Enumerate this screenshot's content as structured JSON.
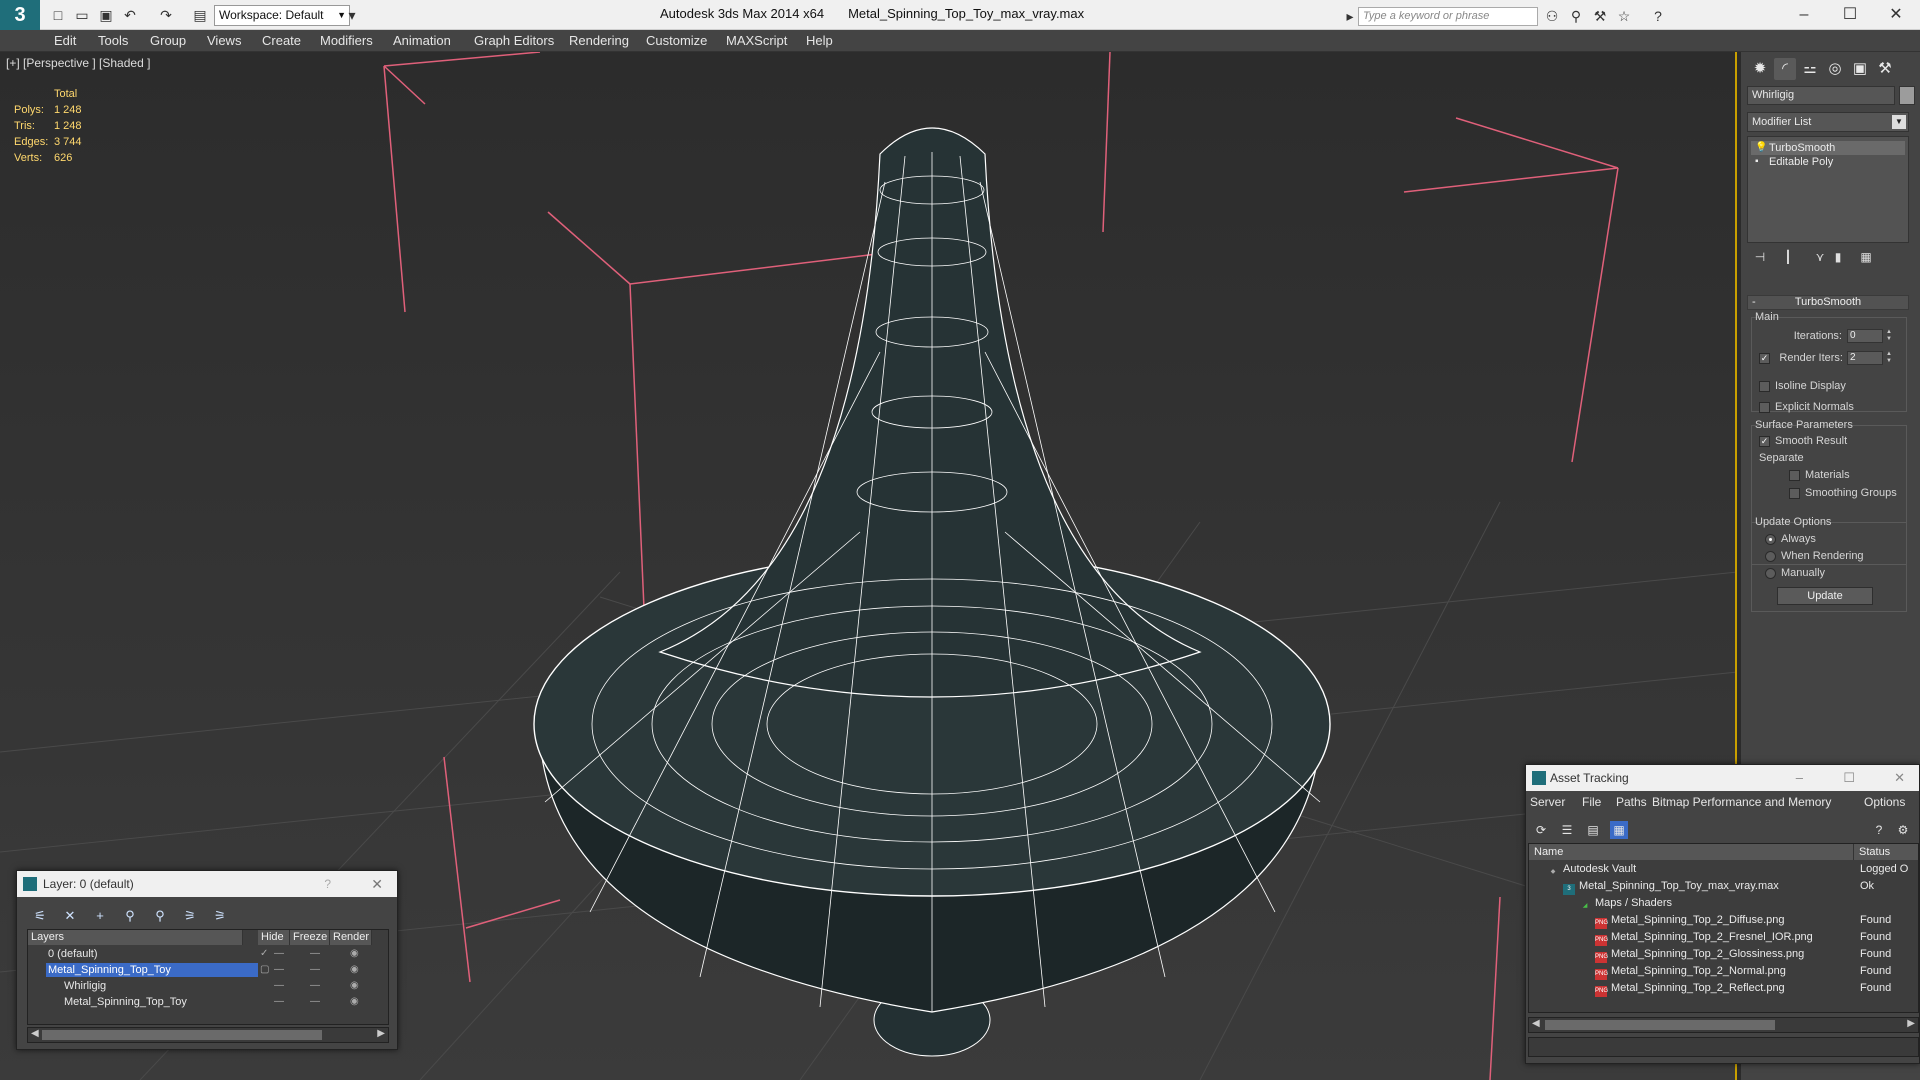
{
  "title_bar": {
    "app_name": "Autodesk 3ds Max  2014 x64",
    "file_name": "Metal_Spinning_Top_Toy_max_vray.max",
    "workspace": "Workspace: Default",
    "search_placeholder": "Type a keyword or phrase"
  },
  "menu": [
    "Edit",
    "Tools",
    "Group",
    "Views",
    "Create",
    "Modifiers",
    "Animation",
    "Graph Editors",
    "Rendering",
    "Customize",
    "MAXScript",
    "Help"
  ],
  "viewport": {
    "label": "[+] [Perspective ] [Shaded ]",
    "stats": {
      "header": "Total",
      "rows": [
        {
          "k": "Polys:",
          "v": "1 248"
        },
        {
          "k": "Tris:",
          "v": "1 248"
        },
        {
          "k": "Edges:",
          "v": "3 744"
        },
        {
          "k": "Verts:",
          "v": "626"
        }
      ]
    }
  },
  "command_panel": {
    "object_name": "Whirligig",
    "modifier_list": "Modifier List",
    "stack": [
      "TurboSmooth",
      "Editable Poly"
    ],
    "turbosmooth": {
      "header": "TurboSmooth",
      "main_label": "Main",
      "iterations_label": "Iterations:",
      "iterations_value": "0",
      "render_iters_label": "Render Iters:",
      "render_iters_value": "2",
      "isoline": "Isoline Display",
      "explicit_normals": "Explicit Normals",
      "surface_params": "Surface Parameters",
      "smooth_result": "Smooth Result",
      "separate": "Separate",
      "materials": "Materials",
      "smoothing_groups": "Smoothing Groups",
      "update_options": "Update Options",
      "always": "Always",
      "when_rendering": "When Rendering",
      "manually": "Manually",
      "update_btn": "Update"
    }
  },
  "layer_dialog": {
    "title": "Layer: 0 (default)",
    "help": "?",
    "columns": [
      "Layers",
      "Hide",
      "Freeze",
      "Render"
    ],
    "rows": [
      "0 (default)",
      "Metal_Spinning_Top_Toy",
      "Whirligig",
      "Metal_Spinning_Top_Toy"
    ]
  },
  "asset_tracking": {
    "title": "Asset Tracking",
    "menu": [
      "Server",
      "File",
      "Paths",
      "Bitmap Performance and Memory",
      "Options"
    ],
    "columns": [
      "Name",
      "Status"
    ],
    "rows": [
      {
        "name": "Autodesk Vault",
        "status": "Logged O"
      },
      {
        "name": "Metal_Spinning_Top_Toy_max_vray.max",
        "status": "Ok"
      },
      {
        "name": "Maps / Shaders",
        "status": ""
      },
      {
        "name": "Metal_Spinning_Top_2_Diffuse.png",
        "status": "Found"
      },
      {
        "name": "Metal_Spinning_Top_2_Fresnel_IOR.png",
        "status": "Found"
      },
      {
        "name": "Metal_Spinning_Top_2_Glossiness.png",
        "status": "Found"
      },
      {
        "name": "Metal_Spinning_Top_2_Normal.png",
        "status": "Found"
      },
      {
        "name": "Metal_Spinning_Top_2_Reflect.png",
        "status": "Found"
      }
    ]
  },
  "colors": {
    "accent": "#c9a000",
    "selection": "#3b6bc7",
    "stats": "#ffd86e",
    "mesh_wire": "#ffffff",
    "bbox": "#e0607a"
  }
}
